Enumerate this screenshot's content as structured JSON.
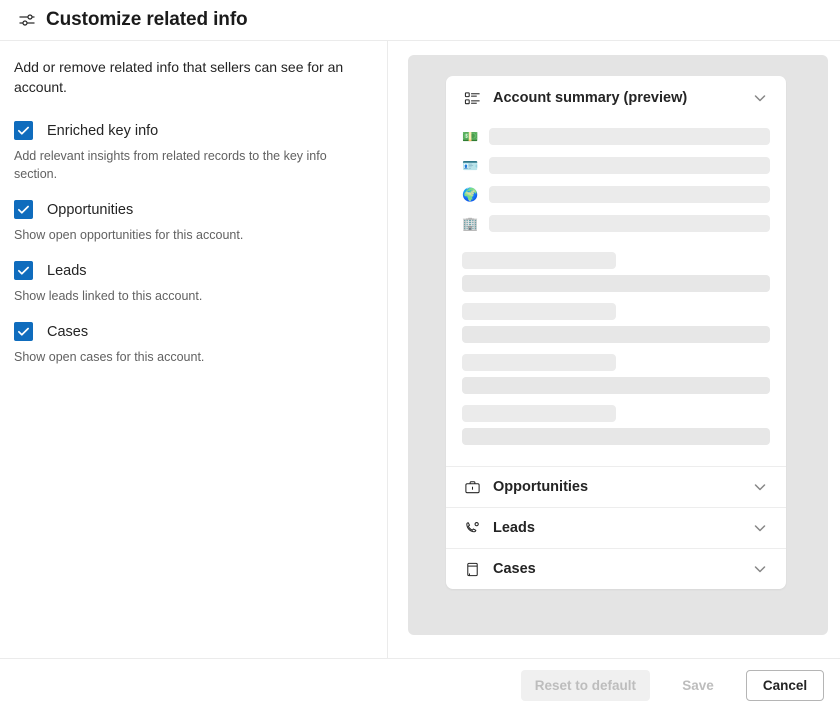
{
  "header": {
    "title": "Customize related info",
    "icon": "settings-sliders-icon"
  },
  "left": {
    "intro": "Add or remove related info that sellers can see for an account.",
    "options": [
      {
        "label": "Enriched key info",
        "description": "Add relevant insights from related records to the key info section.",
        "checked": true
      },
      {
        "label": "Opportunities",
        "description": "Show open opportunities for this account.",
        "checked": true
      },
      {
        "label": "Leads",
        "description": "Show leads linked to this account.",
        "checked": true
      },
      {
        "label": "Cases",
        "description": "Show open cases for this account.",
        "checked": true
      }
    ]
  },
  "preview": {
    "card_title": "Account summary (preview)",
    "card_icon": "summary-list-icon",
    "key_info_rows": [
      {
        "icon": "money-icon",
        "emoji": "💵"
      },
      {
        "icon": "id-card-icon",
        "emoji": "🪪"
      },
      {
        "icon": "globe-icon",
        "emoji": "🌍"
      },
      {
        "icon": "office-building-icon",
        "emoji": "🏢"
      }
    ],
    "skeleton_pairs": 4,
    "sections": [
      {
        "label": "Opportunities",
        "icon": "briefcase-icon"
      },
      {
        "label": "Leads",
        "icon": "phone-gear-icon"
      },
      {
        "label": "Cases",
        "icon": "clipboard-icon"
      }
    ]
  },
  "footer": {
    "reset_label": "Reset to default",
    "save_label": "Save",
    "cancel_label": "Cancel"
  },
  "colors": {
    "accent": "#0f6cbd",
    "panel_bg": "#e4e4e4",
    "skeleton": "#ebebeb",
    "text": "#242424",
    "muted": "#616161"
  }
}
